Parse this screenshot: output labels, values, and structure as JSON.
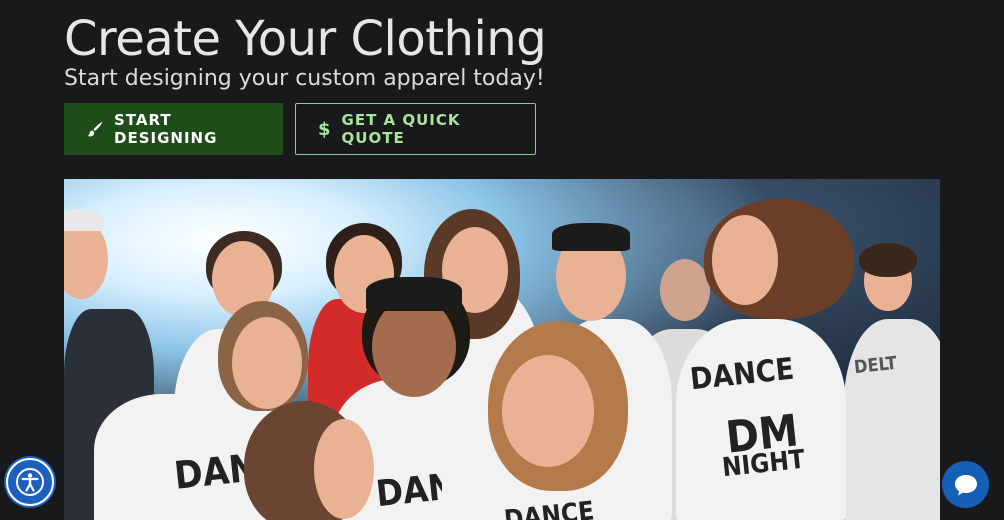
{
  "hero": {
    "title": "Create Your Clothing",
    "subtitle": "Start designing your custom apparel today!"
  },
  "buttons": {
    "start_designing": {
      "label": "START DESIGNING",
      "icon": "paintbrush-icon"
    },
    "quick_quote": {
      "label": "GET A QUICK QUOTE",
      "icon": "dollar-icon"
    }
  },
  "photo": {
    "alt": "Group of students in white shirts cheering at a dance marathon",
    "shirt_prints": [
      "DANCE",
      "DM",
      "NIGHT",
      "DANCE",
      "DANC",
      "DANCE",
      "DELT"
    ]
  },
  "widgets": {
    "accessibility_icon": "accessibility-icon",
    "chat_icon": "chat-bubble-icon"
  },
  "colors": {
    "background": "#18191b",
    "primary_button": "#1e4d19",
    "outline_button": "#88d17b",
    "widget_blue": "#1b5fbf"
  }
}
